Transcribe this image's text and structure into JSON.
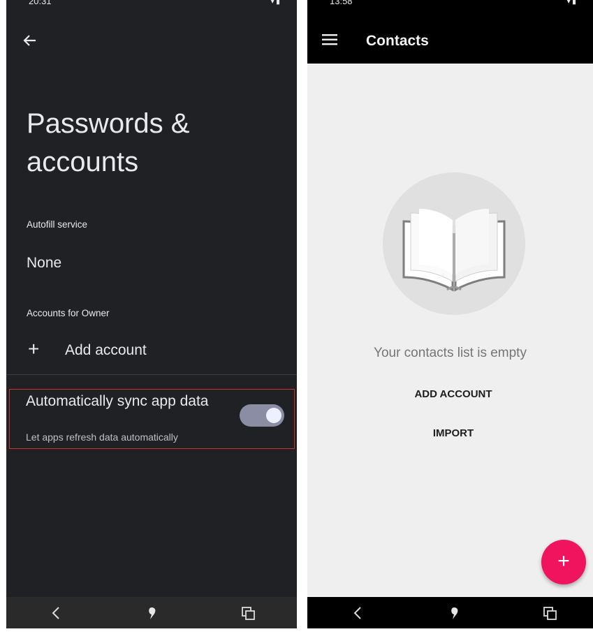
{
  "left_screen": {
    "status_time": "20:31",
    "title": "Passwords & accounts",
    "autofill_label": "Autofill service",
    "autofill_value": "None",
    "accounts_label": "Accounts for Owner",
    "add_account": "Add account",
    "sync": {
      "title": "Automatically sync app data",
      "summary": "Let apps refresh data automatically",
      "enabled": true
    }
  },
  "right_screen": {
    "status_time": "13:58",
    "app_title": "Contacts",
    "empty_message": "Your contacts list is empty",
    "add_account_button": "ADD ACCOUNT",
    "import_button": "IMPORT",
    "fab_label": "+"
  },
  "colors": {
    "dark_background": "#202124",
    "highlight_border": "#d22e2e",
    "fab": "#f0135d",
    "toggle_track": "#8a8da3"
  },
  "icons": [
    "back-arrow-icon",
    "plus-icon",
    "menu-icon",
    "book-icon",
    "nav-back-icon",
    "nav-home-icon",
    "nav-recents-icon",
    "chat-icon",
    "wifi-icon",
    "battery-icon"
  ]
}
